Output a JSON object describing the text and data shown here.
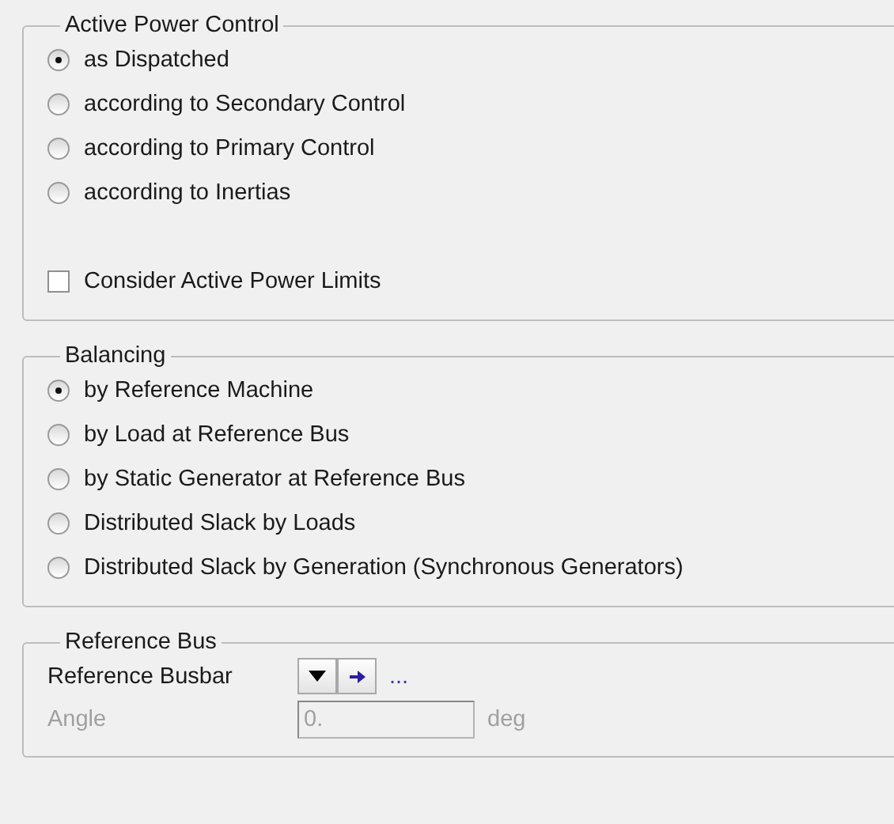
{
  "groups": [
    {
      "title": "Active Power Control",
      "options": [
        {
          "kind": "radio",
          "label": "as Dispatched",
          "selected": true
        },
        {
          "kind": "radio",
          "label": "according to Secondary Control",
          "selected": false
        },
        {
          "kind": "radio",
          "label": "according to Primary Control",
          "selected": false
        },
        {
          "kind": "radio",
          "label": "according to Inertias",
          "selected": false
        },
        {
          "kind": "checkbox",
          "label": "Consider Active Power Limits",
          "checked": false
        }
      ]
    },
    {
      "title": "Balancing",
      "options": [
        {
          "kind": "radio",
          "label": "by Reference Machine",
          "selected": true
        },
        {
          "kind": "radio",
          "label": "by Load at Reference Bus",
          "selected": false
        },
        {
          "kind": "radio",
          "label": "by Static Generator at Reference Bus",
          "selected": false
        },
        {
          "kind": "radio",
          "label": "Distributed Slack by Loads",
          "selected": false
        },
        {
          "kind": "radio",
          "label": "Distributed Slack by Generation (Synchronous Generators)",
          "selected": false
        }
      ]
    },
    {
      "title": "Reference Bus",
      "fields": [
        {
          "kind": "selector",
          "label": "Reference Busbar",
          "value": "...",
          "disabled": false
        },
        {
          "kind": "number",
          "label": "Angle",
          "value": "0.",
          "unit": "deg",
          "disabled": true
        }
      ]
    }
  ]
}
